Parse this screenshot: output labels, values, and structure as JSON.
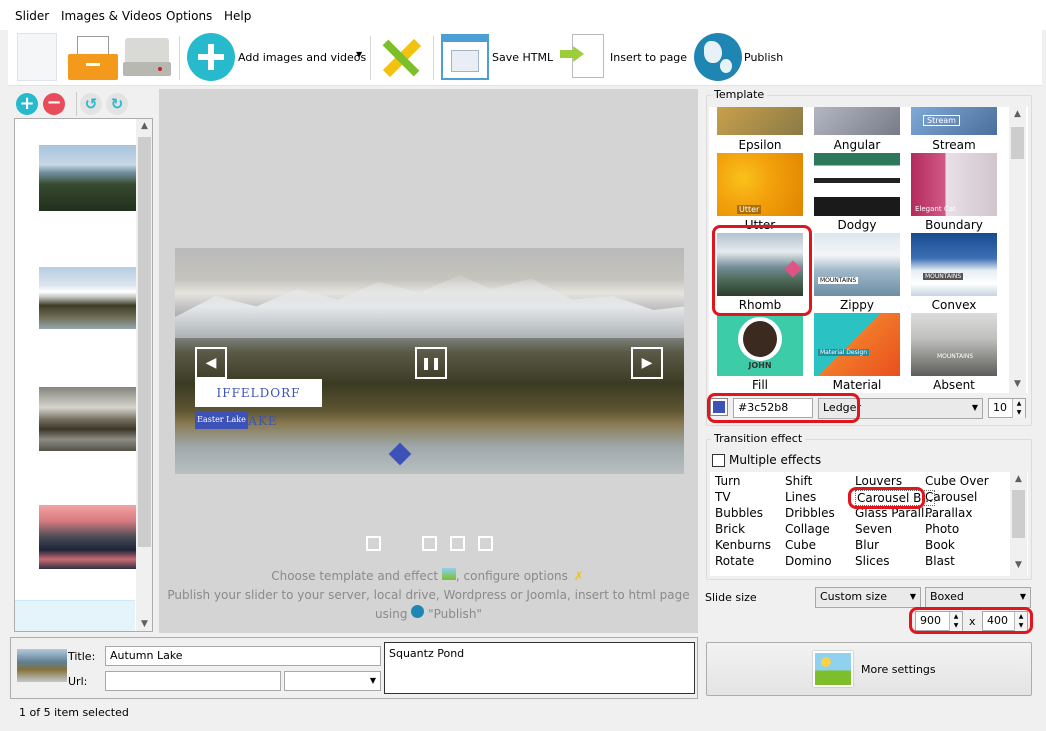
{
  "menu": [
    "Slider",
    "Images & Videos",
    "Options",
    "Help"
  ],
  "toolbar": {
    "add_label": "Add images and videos",
    "save_label": "Save HTML",
    "insert_label": "Insert to page",
    "publish_label": "Publish"
  },
  "thumbnails": [
    "mountain valley",
    "snow mountains",
    "river castle",
    "sunset town"
  ],
  "preview": {
    "caption_title": "IFFELDORF LAKE",
    "caption_sub": "Easter Lake",
    "hint1": "Choose template and effect",
    "hint1b": ", configure options",
    "hint2": "Publish your slider to your server, local drive, Wordpress or Joomla, insert to html page",
    "hint3": "using",
    "hint3b": "\"Publish\""
  },
  "template": {
    "section_label": "Template",
    "items": [
      {
        "name": "Epsilon"
      },
      {
        "name": "Angular"
      },
      {
        "name": "Stream"
      },
      {
        "name": "Utter"
      },
      {
        "name": "Dodgy"
      },
      {
        "name": "Boundary"
      },
      {
        "name": "Rhomb"
      },
      {
        "name": "Zippy"
      },
      {
        "name": "Convex"
      },
      {
        "name": "Fill"
      },
      {
        "name": "Material"
      },
      {
        "name": "Absent"
      }
    ],
    "thumb_texts": {
      "stream": "Stream",
      "utter": "Utter",
      "boundary": "Elegant Cat",
      "zippy": "MOUNTAINS",
      "convex": "MOUNTAINS",
      "fill": "JOHN",
      "material": "Material Design",
      "absent": "MOUNTAINS"
    },
    "color_value": "#3c52b8",
    "color_hex": "#3c52b8",
    "theme": "Ledger",
    "font_size": "10"
  },
  "transition": {
    "section_label": "Transition effect",
    "multiple_label": "Multiple effects",
    "col1": [
      "Turn",
      "TV",
      "Bubbles",
      "Brick",
      "Kenburns",
      "Rotate"
    ],
    "col2": [
      "Shift",
      "Lines",
      "Dribbles",
      "Collage",
      "Cube",
      "Domino"
    ],
    "col3": [
      "Louvers",
      "Carousel B...",
      "Glass Parall...",
      "Seven",
      "Blur",
      "Slices"
    ],
    "col4": [
      "Cube Over",
      "Carousel",
      "Parallax",
      "Photo",
      "Book",
      "Blast"
    ]
  },
  "slide_size": {
    "label": "Slide size",
    "mode": "Custom size",
    "layout": "Boxed",
    "width": "900",
    "x_label": "x",
    "height": "400"
  },
  "more_settings": "More settings",
  "item": {
    "title_label": "Title:",
    "title_value": "Autumn Lake",
    "url_label": "Url:",
    "url_value": "",
    "description": "Squantz Pond"
  },
  "status": "1 of 5 item selected",
  "colors": {
    "accent": "#3c52b8",
    "highlight": "#e0161c"
  }
}
